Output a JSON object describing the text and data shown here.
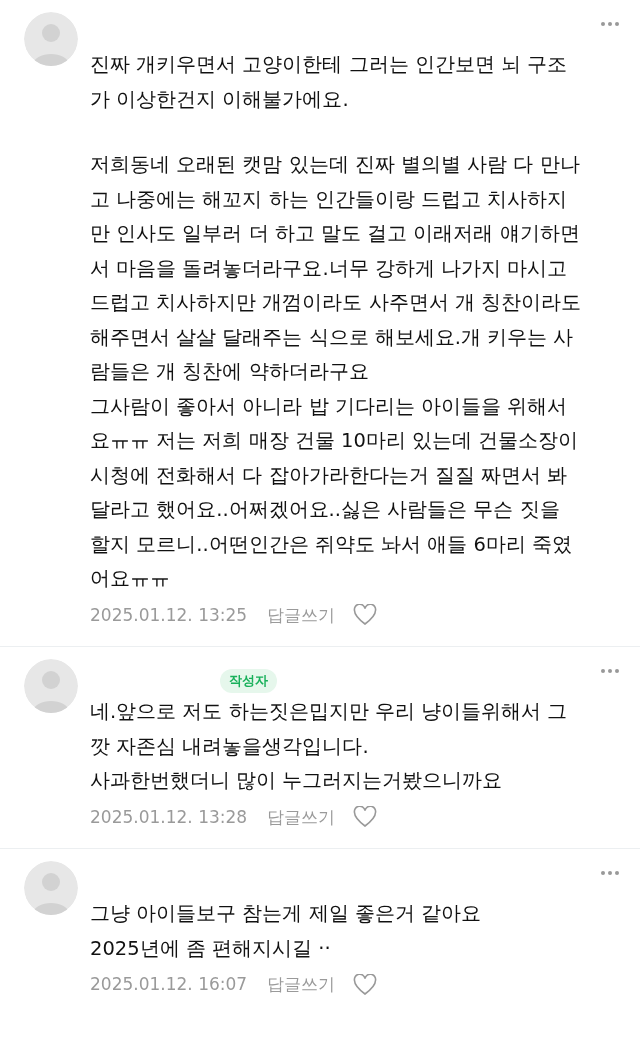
{
  "comments": [
    {
      "paragraphs": [
        [
          "진짜 개키우면서 고양이한테 그러는 인간보면 뇌 구조",
          "가 이상한건지 이해불가에요."
        ],
        [
          "저희동네 오래된 캣맘 있는데 진짜 별의별 사람 다 만나",
          "고 나중에는 해꼬지 하는 인간들이랑 드럽고 치사하지",
          "만 인사도 일부러 더 하고 말도 걸고 이래저래 얘기하면",
          "서 마음을 돌려놓더라구요.너무 강하게 나가지 마시고",
          "드럽고 치사하지만 개껌이라도 사주면서 개 칭찬이라도",
          "해주면서 살살 달래주는 식으로 해보세요.개 키우는 사",
          "람들은 개 칭찬에 약하더라구요",
          "그사람이 좋아서 아니라 밥 기다리는 아이들을 위해서",
          "요ㅠㅠ 저는 저희 매장 건물 10마리 있는데 건물소장이",
          "시청에 전화해서 다 잡아가라한다는거 질질 짜면서 봐",
          "달라고 했어요..어쩌겠어요..싫은 사람들은 무슨 짓을",
          "할지 모르니..어떤인간은 쥐약도 놔서 애들 6마리 죽였",
          "어요ㅠㅠ"
        ]
      ],
      "date": "2025.01.12. 13:25",
      "reply": "답글쓰기"
    },
    {
      "author_badge": "작성자",
      "paragraphs": [
        [
          "네.앞으로 저도 하는짓은밉지만 우리 냥이들위해서 그",
          "깟 자존심 내려놓을생각입니다.",
          "사과한번했더니 많이 누그러지는거봤으니까요"
        ]
      ],
      "date": "2025.01.12. 13:28",
      "reply": "답글쓰기"
    },
    {
      "paragraphs": [
        [
          "그냥 아이들보구 참는게 제일 좋은거 같아요",
          "2025년에 좀 편해지시길  ··"
        ]
      ],
      "date": "2025.01.12. 16:07",
      "reply": "답글쓰기"
    }
  ]
}
